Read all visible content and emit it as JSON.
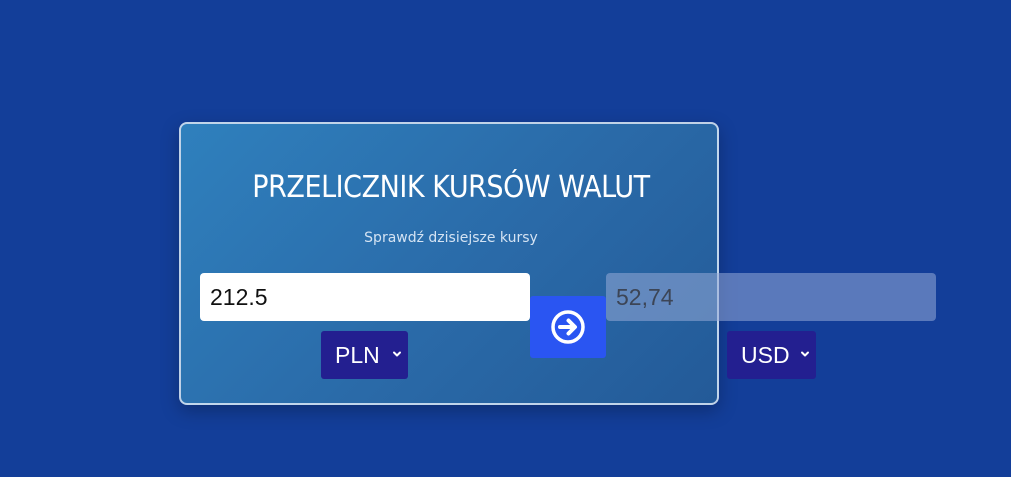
{
  "converter": {
    "title": "PRZELICZNIK KURSÓW WALUT",
    "subtitle": "Sprawdź dzisiejsze kursy",
    "amount_value": "212.5",
    "result_value": "52,74",
    "from_currency": "PLN",
    "to_currency": "USD",
    "convert_icon": "arrow-circle-right-icon"
  },
  "colors": {
    "background": "#133e99",
    "card_gradient_start": "#2f80bd",
    "card_gradient_end": "#235a98",
    "convert_button": "#2a55f2",
    "select_background": "#231f90"
  }
}
